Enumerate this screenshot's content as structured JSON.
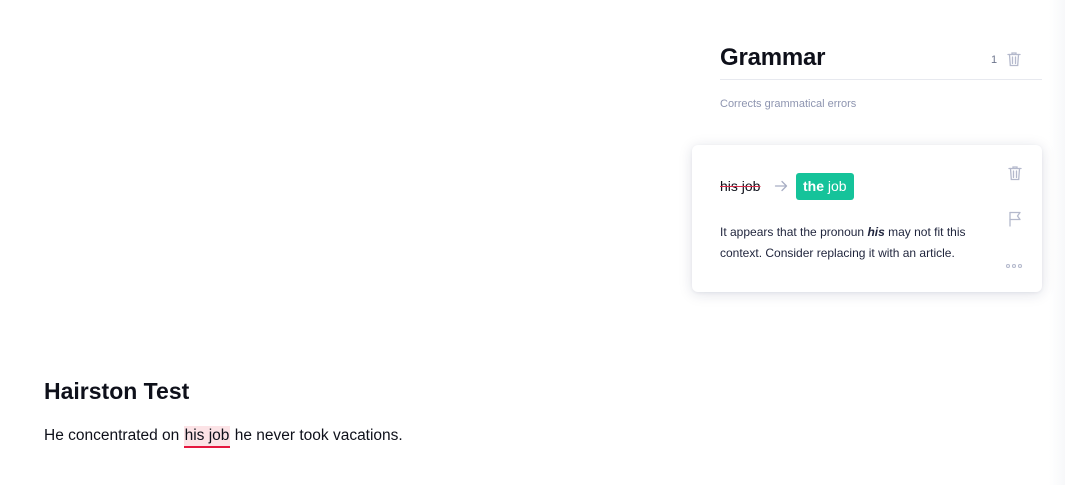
{
  "panel": {
    "title": "Grammar",
    "count": "1",
    "subtitle": "Corrects grammatical errors",
    "icons": {
      "delete": "trash-icon"
    }
  },
  "card": {
    "original": "his job",
    "replacement_bold": "the",
    "replacement_rest": " job",
    "explanation_before": "It appears that the pronoun ",
    "explanation_emph": "his",
    "explanation_after": " may not fit this context. Consider replacing it with an article.",
    "icons": {
      "arrow": "arrow-right-icon",
      "delete": "trash-icon",
      "flag": "flag-icon",
      "more": "more-dots-icon"
    }
  },
  "document": {
    "title": "Hairston Test",
    "text_before": "He concentrated on ",
    "text_highlight": "his job",
    "text_after": " he never took vacations."
  },
  "colors": {
    "accent_green": "#15c39a",
    "error_red": "#e5173f",
    "highlight_bg": "#fce3e6",
    "muted_text": "#8e95b0",
    "icon_gray": "#b4b9cc"
  }
}
